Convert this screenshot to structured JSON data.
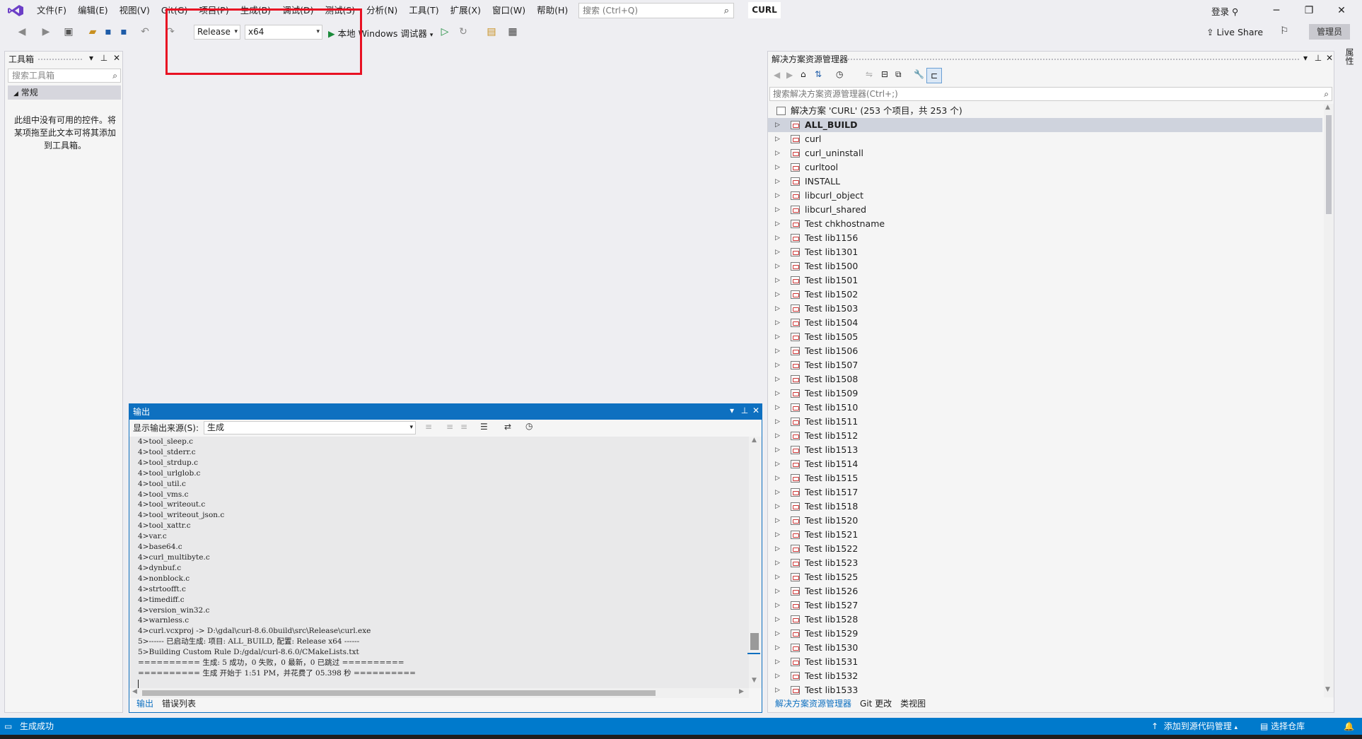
{
  "menu": [
    "文件(F)",
    "编辑(E)",
    "视图(V)",
    "Git(G)",
    "项目(P)",
    "生成(B)",
    "调试(D)",
    "测试(S)",
    "分析(N)",
    "工具(T)",
    "扩展(X)",
    "窗口(W)",
    "帮助(H)"
  ],
  "search": {
    "placeholder": "搜索 (Ctrl+Q)"
  },
  "solution_title": "CURL",
  "login": "登录",
  "toolbar": {
    "config": "Release",
    "platform": "x64",
    "run_label": "本地 Windows 调试器",
    "live_share": "Live Share",
    "admin": "管理员"
  },
  "toolbox": {
    "title": "工具箱",
    "search_placeholder": "搜索工具箱",
    "group": "常规",
    "empty_text": "此组中没有可用的控件。将某项拖至此文本可将其添加到工具箱。"
  },
  "output": {
    "title": "输出",
    "source_label": "显示输出来源(S):",
    "source_value": "生成",
    "lines": [
      "4>tool_sleep.c",
      "4>tool_stderr.c",
      "4>tool_strdup.c",
      "4>tool_urlglob.c",
      "4>tool_util.c",
      "4>tool_vms.c",
      "4>tool_writeout.c",
      "4>tool_writeout_json.c",
      "4>tool_xattr.c",
      "4>var.c",
      "4>base64.c",
      "4>curl_multibyte.c",
      "4>dynbuf.c",
      "4>nonblock.c",
      "4>strtoofft.c",
      "4>timediff.c",
      "4>version_win32.c",
      "4>warnless.c",
      "4>curl.vcxproj -> D:\\gdal\\curl-8.6.0build\\src\\Release\\curl.exe",
      "5>------ 已启动生成: 项目: ALL_BUILD, 配置: Release x64 ------",
      "5>Building Custom Rule D:/gdal/curl-8.6.0/CMakeLists.txt",
      "========== 生成: 5 成功，0 失败，0 最新，0 已跳过 ==========",
      "========== 生成 开始于 1:51 PM，并花费了 05.398 秒 =========="
    ],
    "tabs": [
      "输出",
      "错误列表"
    ]
  },
  "solution_explorer": {
    "title": "解决方案资源管理器",
    "search_placeholder": "搜索解决方案资源管理器(Ctrl+;)",
    "solution_node": "解决方案 'CURL' (253 个项目，共 253 个)",
    "items": [
      "ALL_BUILD",
      "curl",
      "curl_uninstall",
      "curltool",
      "INSTALL",
      "libcurl_object",
      "libcurl_shared",
      "Test chkhostname",
      "Test lib1156",
      "Test lib1301",
      "Test lib1500",
      "Test lib1501",
      "Test lib1502",
      "Test lib1503",
      "Test lib1504",
      "Test lib1505",
      "Test lib1506",
      "Test lib1507",
      "Test lib1508",
      "Test lib1509",
      "Test lib1510",
      "Test lib1511",
      "Test lib1512",
      "Test lib1513",
      "Test lib1514",
      "Test lib1515",
      "Test lib1517",
      "Test lib1518",
      "Test lib1520",
      "Test lib1521",
      "Test lib1522",
      "Test lib1523",
      "Test lib1525",
      "Test lib1526",
      "Test lib1527",
      "Test lib1528",
      "Test lib1529",
      "Test lib1530",
      "Test lib1531",
      "Test lib1532",
      "Test lib1533"
    ],
    "tabs": [
      "解决方案资源管理器",
      "Git 更改",
      "类视图"
    ]
  },
  "right_strip": "属性",
  "status": {
    "left": "生成成功",
    "source_control": "添加到源代码管理",
    "repo": "选择仓库"
  },
  "colors": {
    "accent": "#007acc",
    "highlight_box": "#e81123"
  }
}
